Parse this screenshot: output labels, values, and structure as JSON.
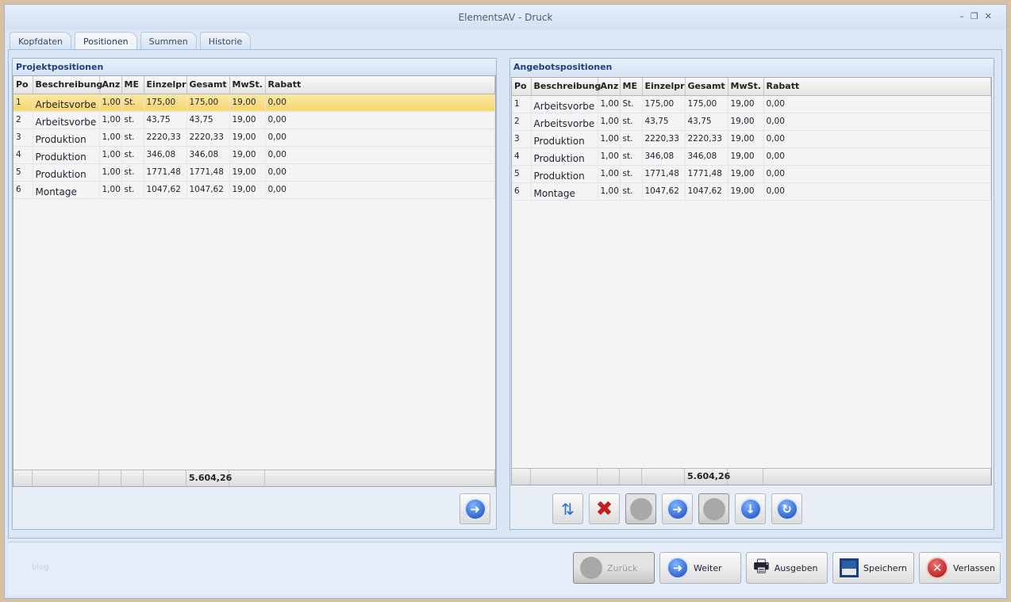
{
  "window": {
    "title": "ElementsAV - Druck"
  },
  "tabs": [
    {
      "label": "Kopfdaten"
    },
    {
      "label": "Positionen",
      "active": true
    },
    {
      "label": "Summen"
    },
    {
      "label": "Historie"
    }
  ],
  "columns": [
    "Po",
    "Beschreibung",
    "Anz",
    "ME",
    "Einzelpr",
    "Gesamt",
    "MwSt.",
    "Rabatt"
  ],
  "left": {
    "title": "Projektpositionen",
    "total": "5.604,26",
    "selected_row": 0,
    "rows": [
      [
        "1",
        "Arbeitsvorbe",
        "1,00",
        "St.",
        "175,00",
        "175,00",
        "19,00",
        "0,00"
      ],
      [
        "2",
        "Arbeitsvorbe",
        "1,00",
        "st.",
        "43,75",
        "43,75",
        "19,00",
        "0,00"
      ],
      [
        "3",
        "Produktion",
        "1,00",
        "st.",
        "2220,33",
        "2220,33",
        "19,00",
        "0,00"
      ],
      [
        "4",
        "Produktion",
        "1,00",
        "st.",
        "346,08",
        "346,08",
        "19,00",
        "0,00"
      ],
      [
        "5",
        "Produktion",
        "1,00",
        "st.",
        "1771,48",
        "1771,48",
        "19,00",
        "0,00"
      ],
      [
        "6",
        "Montage",
        "1,00",
        "st.",
        "1047,62",
        "1047,62",
        "19,00",
        "0,00"
      ]
    ]
  },
  "right": {
    "title": "Angebotspositionen",
    "total": "5.604,26",
    "rows": [
      [
        "1",
        "Arbeitsvorbe",
        "1,00",
        "St.",
        "175,00",
        "175,00",
        "19,00",
        "0,00"
      ],
      [
        "2",
        "Arbeitsvorbe",
        "1,00",
        "st.",
        "43,75",
        "43,75",
        "19,00",
        "0,00"
      ],
      [
        "3",
        "Produktion",
        "1,00",
        "st.",
        "2220,33",
        "2220,33",
        "19,00",
        "0,00"
      ],
      [
        "4",
        "Produktion",
        "1,00",
        "st.",
        "346,08",
        "346,08",
        "19,00",
        "0,00"
      ],
      [
        "5",
        "Produktion",
        "1,00",
        "st.",
        "1771,48",
        "1771,48",
        "19,00",
        "0,00"
      ],
      [
        "6",
        "Montage",
        "1,00",
        "st.",
        "1047,62",
        "1047,62",
        "19,00",
        "0,00"
      ]
    ]
  },
  "bottom": {
    "watermark": "blog",
    "zurueck": "Zurück",
    "weiter": "Weiter",
    "ausgeben": "Ausgeben",
    "speichern": "Speichern",
    "verlassen": "Verlassen"
  },
  "icons": {
    "refresh": "refresh-doc-icon",
    "delete": "delete-x-icon",
    "right": "arrow-right-icon",
    "down": "arrow-down-icon",
    "redo": "redo-icon",
    "print": "printer-icon",
    "save": "floppy-icon",
    "exit": "exit-icon"
  }
}
